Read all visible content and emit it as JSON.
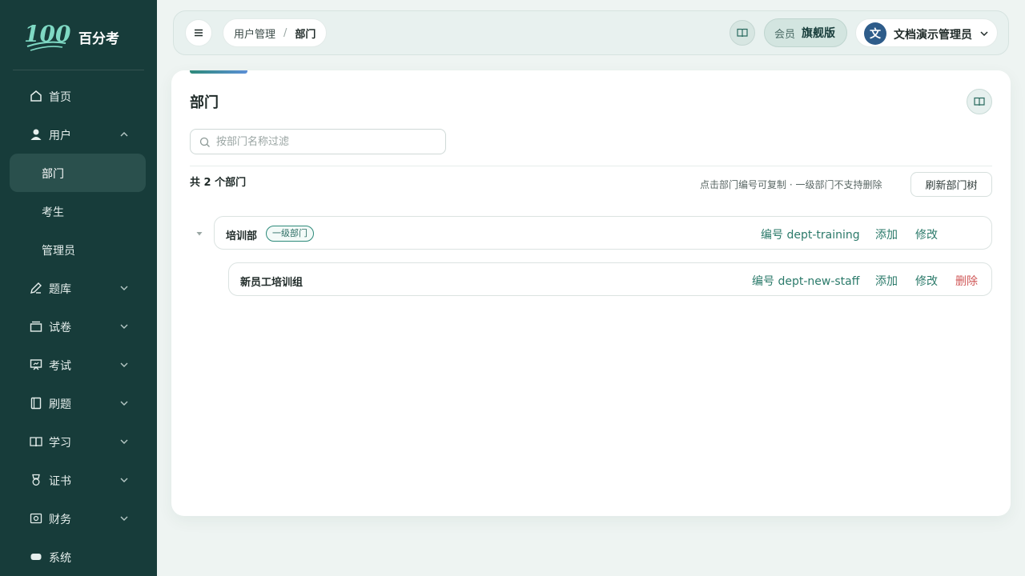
{
  "sidebar": {
    "logo_text": "百分考",
    "items": [
      {
        "label": "首页"
      },
      {
        "label": "用户"
      },
      {
        "label": "题库"
      },
      {
        "label": "试卷"
      },
      {
        "label": "考试"
      },
      {
        "label": "刷题"
      },
      {
        "label": "学习"
      },
      {
        "label": "证书"
      },
      {
        "label": "财务"
      },
      {
        "label": "系统"
      }
    ],
    "sub_items": [
      {
        "label": "部门",
        "active": true
      },
      {
        "label": "考生"
      },
      {
        "label": "管理员"
      }
    ]
  },
  "header": {
    "breadcrumb": [
      "用户管理",
      "部门"
    ],
    "breadcrumb_sep": "/",
    "member_label": "会员",
    "member_tier": "旗舰版",
    "avatar_initial": "文",
    "user_name": "文档演示管理员"
  },
  "main": {
    "title": "部门",
    "search_placeholder": "按部门名称过滤",
    "count_text": "共 2 个部门",
    "hint": "点击部门编号可复制 · 一级部门不支持删除",
    "refresh_label": "刷新部门树",
    "departments": [
      {
        "name": "培训部",
        "tag": "一级部门",
        "code": "编号 dept-training",
        "add_label": "添加",
        "edit_label": "修改"
      },
      {
        "name": "新员工培训组",
        "code": "编号 dept-new-staff",
        "add_label": "添加",
        "edit_label": "修改",
        "delete_label": "删除"
      }
    ]
  },
  "colors": {
    "sidebar_bg": "#173c3a",
    "accent": "#2b7a6a",
    "danger": "#d05858"
  }
}
